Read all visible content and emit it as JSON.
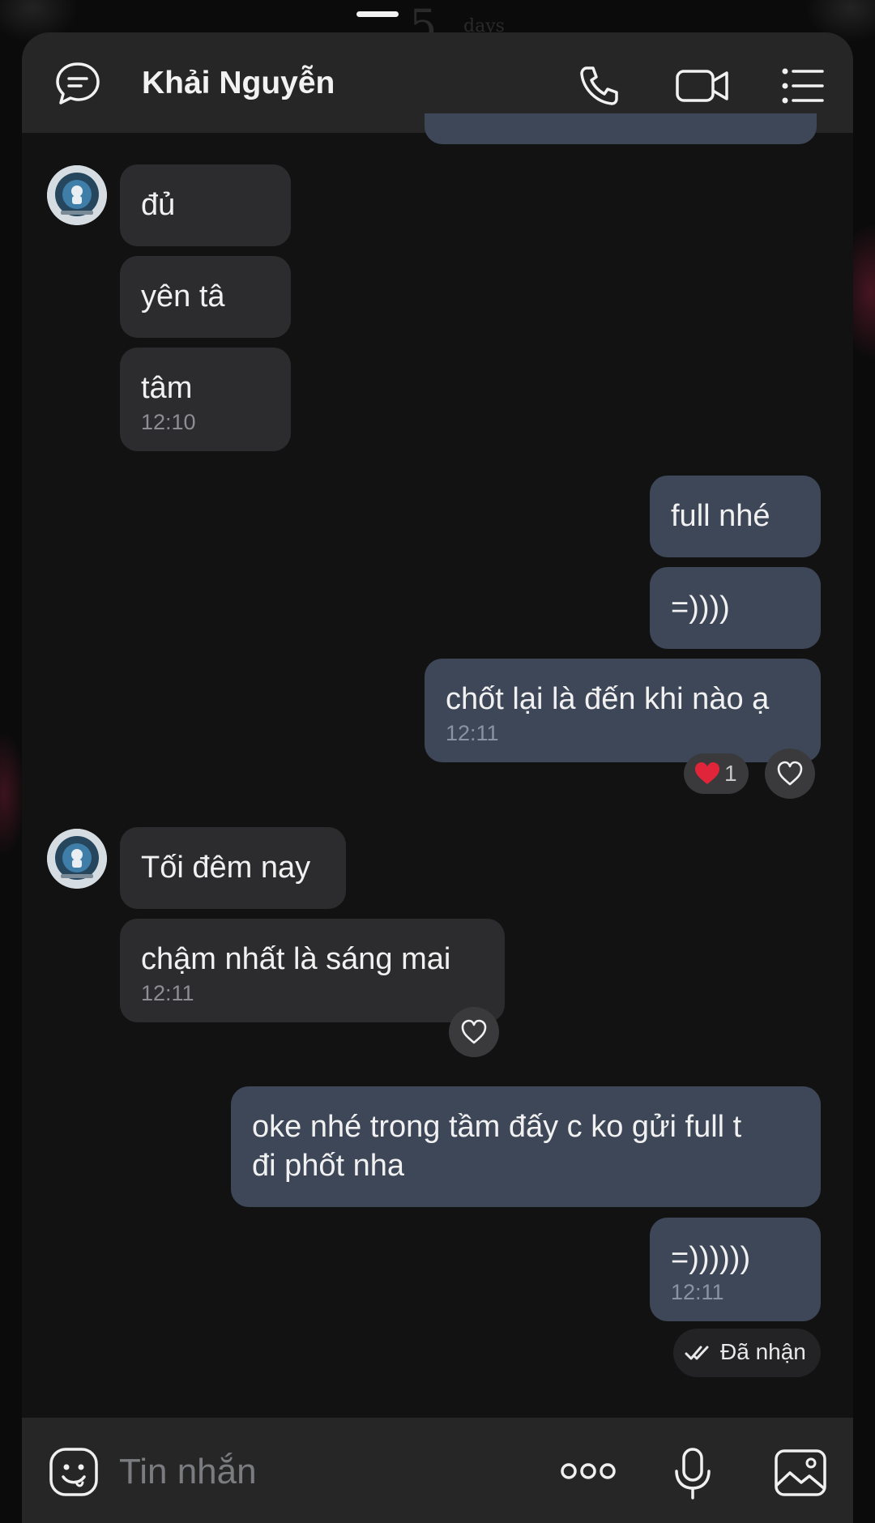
{
  "header": {
    "contact_name": "Khải Nguyễn",
    "icons": [
      "chat-bubble-icon",
      "phone-icon",
      "video-icon",
      "menu-list-icon"
    ]
  },
  "background": {
    "ghost_digit": "5",
    "ghost_word": "days"
  },
  "messages": [
    {
      "side": "in",
      "text": "đủ"
    },
    {
      "side": "in",
      "text": "yên tâ"
    },
    {
      "side": "in",
      "text": "tâm",
      "time": "12:10"
    },
    {
      "side": "out",
      "text": "full nhé"
    },
    {
      "side": "out",
      "text": "=))))"
    },
    {
      "side": "out",
      "text": "chốt lại là đến khi nào ạ",
      "time": "12:11",
      "reaction_count": "1"
    },
    {
      "side": "in",
      "text": "Tối đêm nay"
    },
    {
      "side": "in",
      "text": "chậm nhất là sáng mai",
      "time": "12:11"
    },
    {
      "side": "out",
      "line1": "oke nhé trong tầm đấy c ko gửi full t",
      "line2": "đi phốt nha"
    },
    {
      "side": "out",
      "text": "=))))))",
      "time": "12:11"
    }
  ],
  "status": {
    "delivered_label": "Đã nhận"
  },
  "composer": {
    "placeholder": "Tin nhắn",
    "icons": [
      "emoji-icon",
      "more-dots-icon",
      "microphone-icon",
      "image-icon"
    ]
  },
  "colors": {
    "incoming_bubble": "#2c2c2e",
    "outgoing_bubble": "#3d4758",
    "background": "#121213",
    "header": "#262627",
    "reaction_heart": "#e0243a"
  }
}
